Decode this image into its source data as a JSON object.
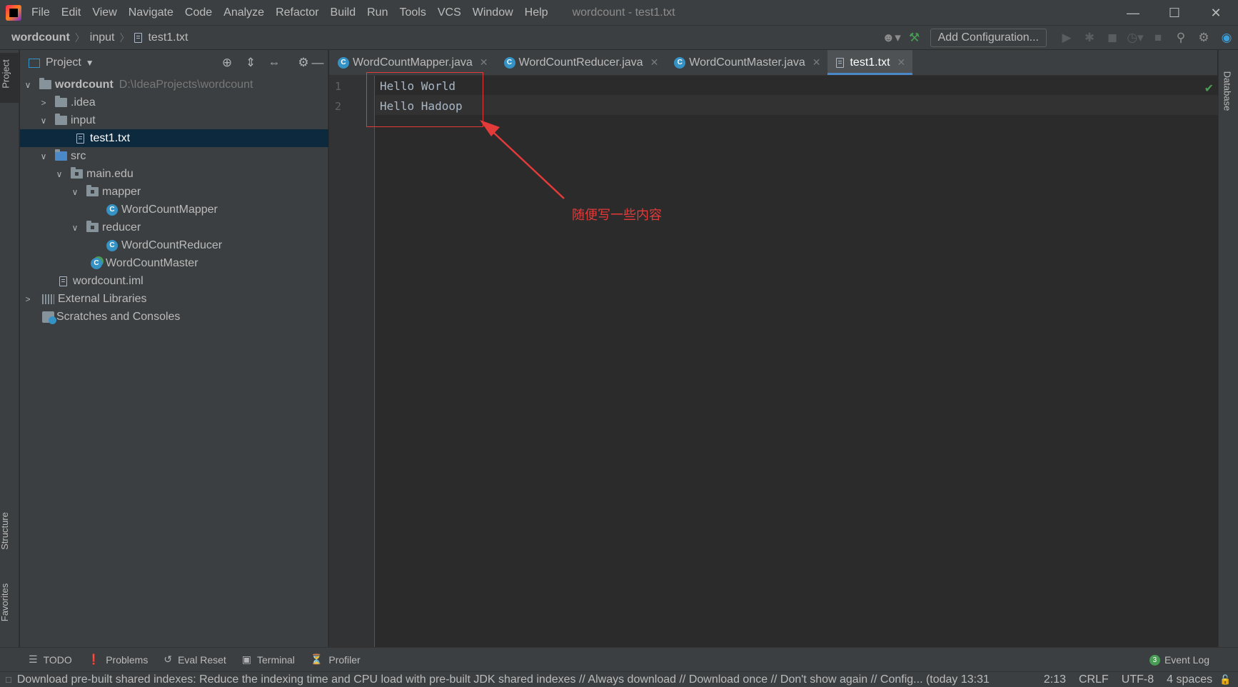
{
  "menubar": {
    "items": [
      "File",
      "Edit",
      "View",
      "Navigate",
      "Code",
      "Analyze",
      "Refactor",
      "Build",
      "Run",
      "Tools",
      "VCS",
      "Window",
      "Help"
    ],
    "title": "wordcount - test1.txt"
  },
  "navbar": {
    "crumbs": [
      "wordcount",
      "input",
      "test1.txt"
    ],
    "add_configuration": "Add Configuration..."
  },
  "left_stripe": {
    "project": "Project",
    "structure": "Structure",
    "favorites": "Favorites"
  },
  "right_stripe": {
    "database": "Database"
  },
  "project_panel": {
    "title": "Project",
    "tree": [
      {
        "label": "wordcount",
        "path": "D:\\IdeaProjects\\wordcount"
      },
      {
        "label": ".idea"
      },
      {
        "label": "input"
      },
      {
        "label": "test1.txt"
      },
      {
        "label": "src"
      },
      {
        "label": "main.edu"
      },
      {
        "label": "mapper"
      },
      {
        "label": "WordCountMapper"
      },
      {
        "label": "reducer"
      },
      {
        "label": "WordCountReducer"
      },
      {
        "label": "WordCountMaster"
      },
      {
        "label": "wordcount.iml"
      },
      {
        "label": "External Libraries"
      },
      {
        "label": "Scratches and Consoles"
      }
    ]
  },
  "editor": {
    "tabs": [
      "WordCountMapper.java",
      "WordCountReducer.java",
      "WordCountMaster.java",
      "test1.txt"
    ],
    "active_tab": "test1.txt",
    "line_numbers": [
      "1",
      "2"
    ],
    "lines": [
      "Hello World",
      "Hello Hadoop"
    ]
  },
  "annotation": {
    "text": "随便写一些内容",
    "color": "#e33a3a"
  },
  "toolwindows": {
    "todo": "TODO",
    "problems": "Problems",
    "eval_reset": "Eval Reset",
    "terminal": "Terminal",
    "profiler": "Profiler",
    "event_log": "Event Log",
    "event_count": "3"
  },
  "statusbar": {
    "message": "Download pre-built shared indexes: Reduce the indexing time and CPU load with pre-built JDK shared indexes // Always download // Download once // Don't show again // Config... (today 13:31",
    "position": "2:13",
    "line_sep": "CRLF",
    "encoding": "UTF-8",
    "indent": "4 spaces"
  },
  "colors": {
    "accent": "#4a88c7",
    "background": "#2b2b2b",
    "panel": "#3c3f41",
    "selection": "#0d293e"
  }
}
